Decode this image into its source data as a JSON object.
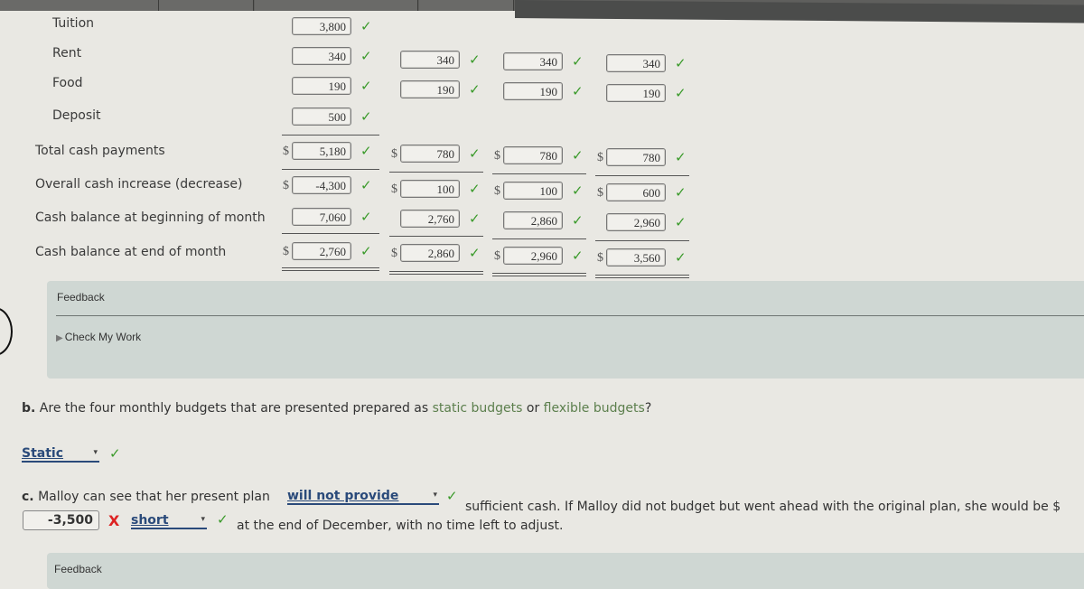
{
  "budget_table": {
    "rows": [
      {
        "key": "tuition",
        "label": "Tuition"
      },
      {
        "key": "rent",
        "label": "Rent"
      },
      {
        "key": "food",
        "label": "Food"
      },
      {
        "key": "deposit",
        "label": "Deposit"
      },
      {
        "key": "total_cash_payments",
        "label": "Total cash payments"
      },
      {
        "key": "overall_cash_change",
        "label": "Overall cash increase (decrease)"
      },
      {
        "key": "cash_begin",
        "label": "Cash balance at beginning of month"
      },
      {
        "key": "cash_end",
        "label": "Cash balance at end of month"
      }
    ],
    "currency_symbol": "$",
    "check_symbol": "✓",
    "columns": [
      {
        "tuition": "3,800",
        "rent": "340",
        "food": "190",
        "deposit": "500",
        "total_cash_payments": "5,180",
        "overall_cash_change": "-4,300",
        "cash_begin": "7,060",
        "cash_end": "2,760"
      },
      {
        "rent": "340",
        "food": "190",
        "total_cash_payments": "780",
        "overall_cash_change": "100",
        "cash_begin": "2,760",
        "cash_end": "2,860"
      },
      {
        "rent": "340",
        "food": "190",
        "total_cash_payments": "780",
        "overall_cash_change": "100",
        "cash_begin": "2,860",
        "cash_end": "2,960"
      },
      {
        "rent": "340",
        "food": "190",
        "total_cash_payments": "780",
        "overall_cash_change": "600",
        "cash_begin": "2,960",
        "cash_end": "3,560"
      }
    ]
  },
  "feedback1": {
    "title": "Feedback",
    "check_my_work": "Check My Work",
    "triangle": "▶"
  },
  "question_b": {
    "prefix": "b.",
    "text_before": " Are the four monthly budgets that are presented prepared as ",
    "term1": "static budgets",
    "middle": " or ",
    "term2": "flexible budgets",
    "end": "?",
    "answer": "Static",
    "answer_status": "correct"
  },
  "question_c": {
    "prefix": "c.",
    "text1": " Malloy can see that her present plan ",
    "select1": "will not provide",
    "select1_status": "correct",
    "text2": " sufficient cash. If Malloy did not budget but went ahead with the original plan, she would be $",
    "amount": "-3,500",
    "amount_status": "incorrect",
    "select2": "short",
    "select2_status": "correct",
    "text3": " at the end of December, with no time left to adjust."
  },
  "feedback2": {
    "title": "Feedback"
  },
  "symbols": {
    "check": "✓",
    "x": "X",
    "dropdown": "▾"
  },
  "colors": {
    "correct": "#3a9a2a",
    "incorrect": "#dd2222",
    "glossary": "#5c7f4d",
    "select": "#2a4a7a",
    "feedback_bg": "#cfd7d3"
  }
}
